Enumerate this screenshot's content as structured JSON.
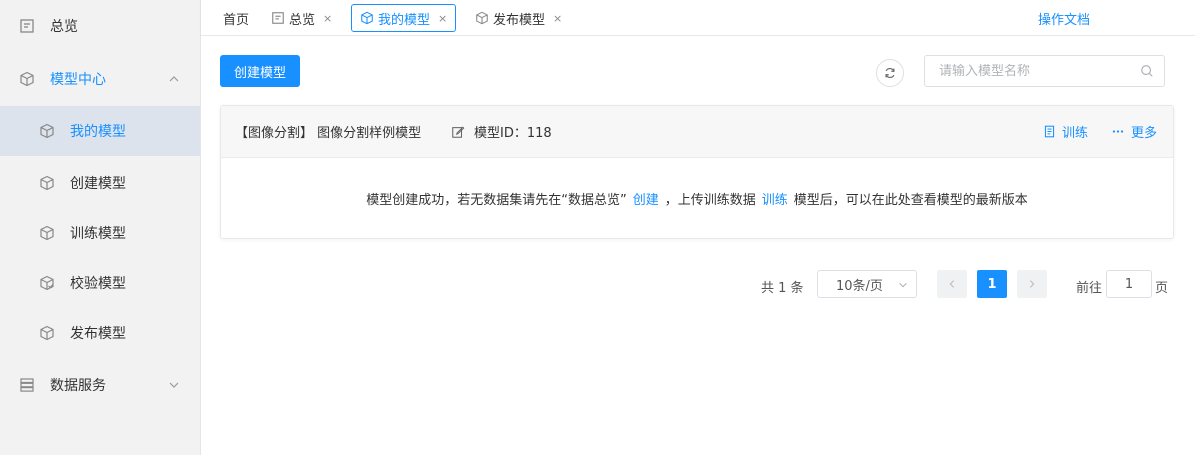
{
  "sidebar": {
    "items": [
      {
        "label": "总览",
        "icon": "dashboard-icon"
      },
      {
        "label": "模型中心",
        "icon": "cube-icon"
      },
      {
        "label": "我的模型",
        "icon": "cube-icon"
      },
      {
        "label": "创建模型",
        "icon": "cube-icon"
      },
      {
        "label": "训练模型",
        "icon": "cube-icon"
      },
      {
        "label": "校验模型",
        "icon": "cube-check-icon"
      },
      {
        "label": "发布模型",
        "icon": "cube-icon"
      },
      {
        "label": "数据服务",
        "icon": "server-icon"
      }
    ]
  },
  "tabs": {
    "home": "首页",
    "overview": "总览",
    "my_models": "我的模型",
    "publish": "发布模型",
    "close": "×",
    "doc_link": "操作文档"
  },
  "toolbar": {
    "create_label": "创建模型",
    "search_placeholder": "请输入模型名称"
  },
  "card": {
    "title": "【图像分割】 图像分割样例模型",
    "model_id": "模型ID：118",
    "train_label": "训练",
    "more_label": "更多",
    "message_pre": "模型创建成功，若无数据集请先在“数据总览”",
    "link_create": "创建",
    "message_mid": "，上传训练数据",
    "link_train": "训练",
    "message_post": "模型后，可以在此处查看模型的最新版本"
  },
  "pagination": {
    "total": "共 1 条",
    "page_size": "10条/页",
    "current_page": "1",
    "goto_label": "前往",
    "goto_value": "1",
    "goto_suffix": "页"
  },
  "colors": {
    "accent": "#1890ff",
    "sidebar_bg": "#f2f2f3",
    "selected_bg": "#dde3ec"
  }
}
